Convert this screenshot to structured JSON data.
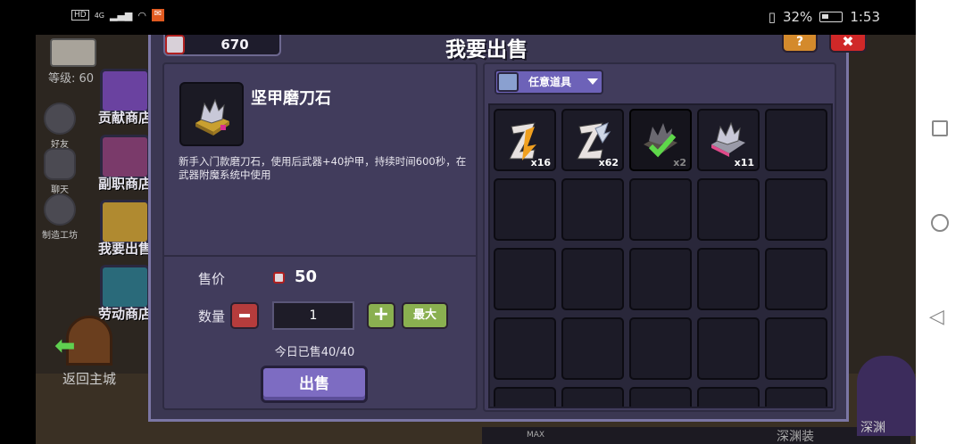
{
  "status_bar": {
    "left_icons": [
      "HD",
      "4G",
      "signal",
      "wifi",
      "1",
      "notif"
    ],
    "battery": "32%",
    "time": "1:53"
  },
  "sidebar": {
    "level": "等级: 60",
    "friend": "好友",
    "chat": "聊天",
    "workshop": "制造工坊",
    "tabs": [
      {
        "label": "贡献商店"
      },
      {
        "label": "副职商店"
      },
      {
        "label": "我要出售"
      },
      {
        "label": "劳动商店"
      }
    ],
    "back_home": "返回主城"
  },
  "background": {
    "abyss_label": "深渊",
    "abyss_label2": "深渊装",
    "max_label": "MAX"
  },
  "panel": {
    "title": "我要出售",
    "currency_value": "670",
    "help_label": "?",
    "close_label": "✖"
  },
  "item": {
    "name": "坚甲磨刀石",
    "description": "新手入门款磨刀石，使用后武器+40护甲，持续时间600秒，在武器附魔系统中使用"
  },
  "sale": {
    "price_label": "售价",
    "price_value": "50",
    "quantity_label": "数量",
    "quantity_value": "1",
    "max_label": "最大",
    "sold_today": "今日已售40/40",
    "sell_button": "出售"
  },
  "inventory": {
    "filter_label": "任意道具",
    "items": [
      {
        "count": "x16"
      },
      {
        "count": "x62"
      },
      {
        "count": "x2"
      },
      {
        "count": "x11"
      }
    ]
  },
  "colors": {
    "panel_bg": "#3b3752",
    "panel_border": "#7b76a4",
    "sell_button": "#7d6cc2",
    "plus_button": "#8ab050",
    "minus_button": "#b53c3c"
  }
}
